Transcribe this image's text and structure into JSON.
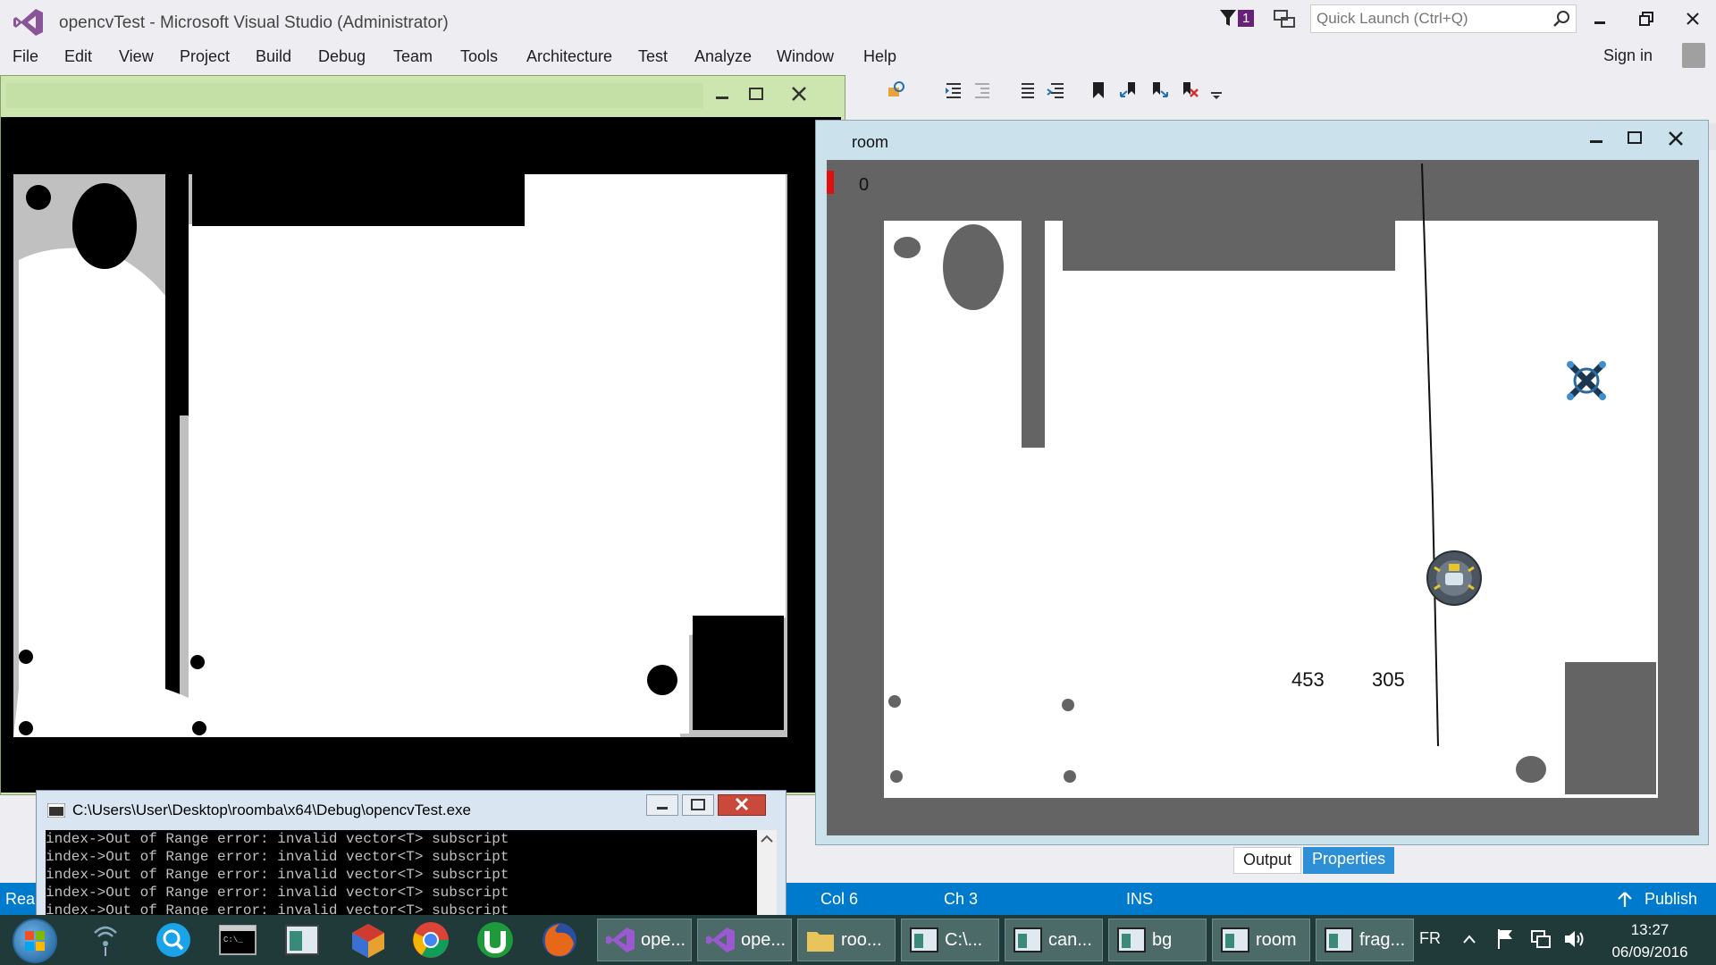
{
  "vs": {
    "title": "opencvTest - Microsoft Visual Studio (Administrator)",
    "notification_count": "1",
    "quick_launch_placeholder": "Quick Launch (Ctrl+Q)",
    "menu": [
      "File",
      "Edit",
      "View",
      "Project",
      "Build",
      "Debug",
      "Team",
      "Tools",
      "Architecture",
      "Test",
      "Analyze",
      "Window",
      "Help"
    ],
    "sign_in": "Sign in",
    "bottom_tabs": [
      "Output",
      "Properties"
    ],
    "status": {
      "left": "Rea",
      "col": "Col 6",
      "ch": "Ch 3",
      "mode": "INS",
      "publish": "Publish"
    }
  },
  "room_window": {
    "title": "room",
    "counter": "0",
    "readout_left": "453",
    "readout_right": "305"
  },
  "console": {
    "title": "C:\\Users\\User\\Desktop\\roomba\\x64\\Debug\\opencvTest.exe",
    "lines": [
      "index->Out of Range error: invalid vector<T> subscript",
      "index->Out of Range error: invalid vector<T> subscript",
      "index->Out of Range error: invalid vector<T> subscript",
      "index->Out of Range error: invalid vector<T> subscript",
      "index->Out of Range error: invalid vector<T> subscript"
    ]
  },
  "taskbar": {
    "tasks": [
      "ope...",
      "ope...",
      "roo...",
      "C:\\...",
      "can...",
      "bg",
      "room",
      "frag..."
    ],
    "language": "FR",
    "time": "13:27",
    "date": "06/09/2016"
  },
  "colors": {
    "vs_accent": "#007acc",
    "vs_purple": "#68217a",
    "taskbar": "#1f3a38",
    "room_bg": "#646464"
  }
}
